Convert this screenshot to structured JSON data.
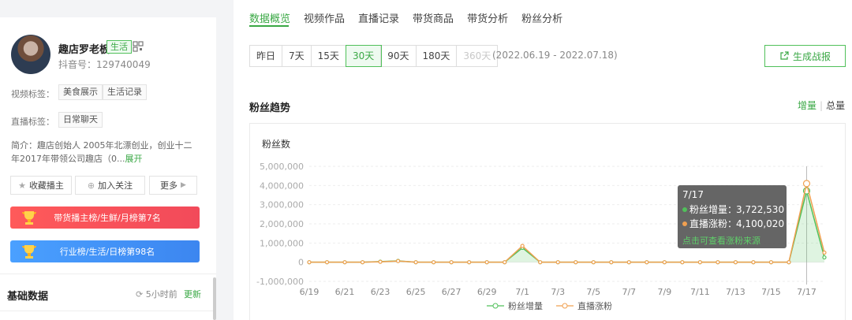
{
  "profile": {
    "name": "趣店罗老板",
    "category_tag": "生活",
    "douyin_id": "抖音号：129740049",
    "video_tags_label": "视频标签：",
    "video_tags": [
      "美食展示",
      "生活记录"
    ],
    "live_tags_label": "直播标签：",
    "live_tags": [
      "日常聊天"
    ],
    "intro": "简介：趣店创始人 2005年北漂创业，创业十二年2017年带领公司趣店（0...",
    "intro_expand": "展开",
    "buttons": {
      "favorite": "收藏播主",
      "follow": "加入关注",
      "more": "更多"
    },
    "rank_banners": [
      "带货播主榜/生鲜/月榜第7名",
      "行业榜/生活/日榜第98名"
    ],
    "basic_data_title": "基础数据",
    "update_time": "5小时前",
    "update_link": "更新"
  },
  "main": {
    "tabs": [
      "数据概览",
      "视频作品",
      "直播记录",
      "带货商品",
      "带货分析",
      "粉丝分析"
    ],
    "active_tab": 0,
    "ranges": [
      "昨日",
      "7天",
      "15天",
      "30天",
      "90天",
      "180天",
      "360天"
    ],
    "selected_range": 3,
    "disabled_range": 6,
    "date_range": "(2022.06.19 - 2022.07.18)",
    "generate_button": "生成战报",
    "section_title": "粉丝趋势",
    "toggle": {
      "increment": "增量",
      "total": "总量"
    }
  },
  "colors": {
    "accent": "#3aa845",
    "series_increment": "#50c05a",
    "series_live": "#f0a050"
  },
  "chart_data": {
    "type": "line",
    "ylabel": "粉丝数",
    "ylim": [
      -1000000,
      5000000
    ],
    "y_ticks": [
      "5,000,000",
      "4,000,000",
      "3,000,000",
      "2,000,000",
      "1,000,000",
      "0",
      "-1,000,000"
    ],
    "x_ticks": [
      "6/19",
      "6/21",
      "6/23",
      "6/25",
      "6/27",
      "6/29",
      "7/1",
      "7/3",
      "7/5",
      "7/7",
      "7/9",
      "7/11",
      "7/13",
      "7/15",
      "7/17"
    ],
    "x": [
      "6/19",
      "6/20",
      "6/21",
      "6/22",
      "6/23",
      "6/24",
      "6/25",
      "6/26",
      "6/27",
      "6/28",
      "6/29",
      "6/30",
      "7/1",
      "7/2",
      "7/3",
      "7/4",
      "7/5",
      "7/6",
      "7/7",
      "7/8",
      "7/9",
      "7/10",
      "7/11",
      "7/12",
      "7/13",
      "7/14",
      "7/15",
      "7/16",
      "7/17",
      "7/18"
    ],
    "series": [
      {
        "name": "粉丝增量",
        "values": [
          0,
          0,
          0,
          0,
          30000,
          70000,
          0,
          0,
          0,
          0,
          0,
          0,
          750000,
          0,
          0,
          0,
          0,
          0,
          0,
          0,
          0,
          0,
          0,
          0,
          0,
          0,
          0,
          0,
          3722530,
          250000
        ]
      },
      {
        "name": "直播涨粉",
        "values": [
          0,
          0,
          0,
          0,
          20000,
          60000,
          0,
          0,
          0,
          0,
          0,
          0,
          850000,
          0,
          0,
          0,
          0,
          0,
          0,
          0,
          0,
          0,
          0,
          0,
          0,
          0,
          0,
          0,
          4100020,
          500000
        ]
      }
    ],
    "tooltip": {
      "date": "7/17",
      "lines": [
        {
          "label": "粉丝增量：",
          "value": "3,722,530"
        },
        {
          "label": "直播涨粉：",
          "value": "4,100,020"
        }
      ],
      "hint": "点击可查看涨粉来源"
    }
  }
}
